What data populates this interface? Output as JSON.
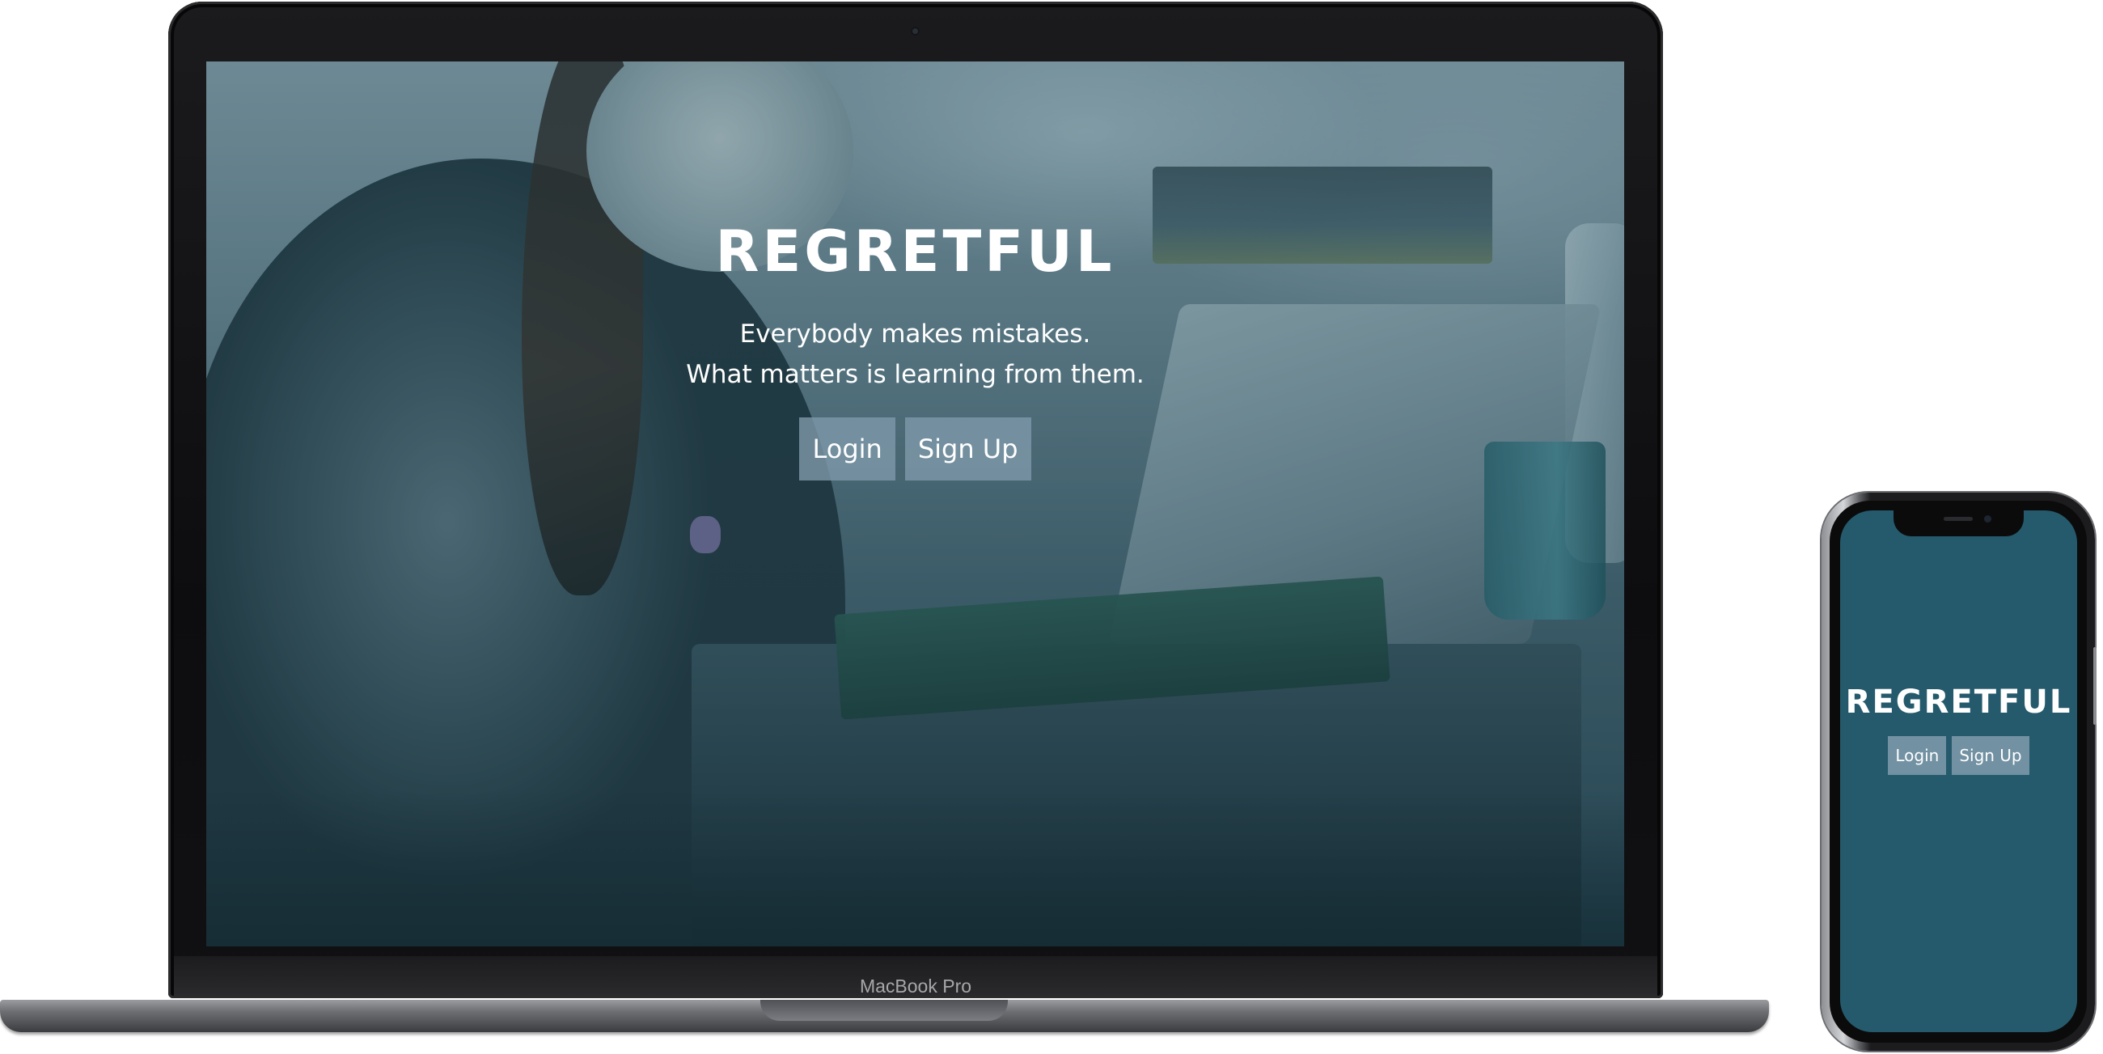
{
  "laptop": {
    "device_label": "MacBook Pro",
    "site": {
      "title": "REGRETFUL",
      "tagline_line1": "Everybody makes mistakes.",
      "tagline_line2": "What matters is learning from them.",
      "login_label": "Login",
      "signup_label": "Sign Up"
    }
  },
  "phone": {
    "site": {
      "title": "REGRETFUL",
      "login_label": "Login",
      "signup_label": "Sign Up"
    }
  },
  "colors": {
    "brand_teal": "#255a6c",
    "button_bg": "#809bac",
    "text": "#ffffff"
  },
  "background_image": "woman-working-on-laptop-photo"
}
